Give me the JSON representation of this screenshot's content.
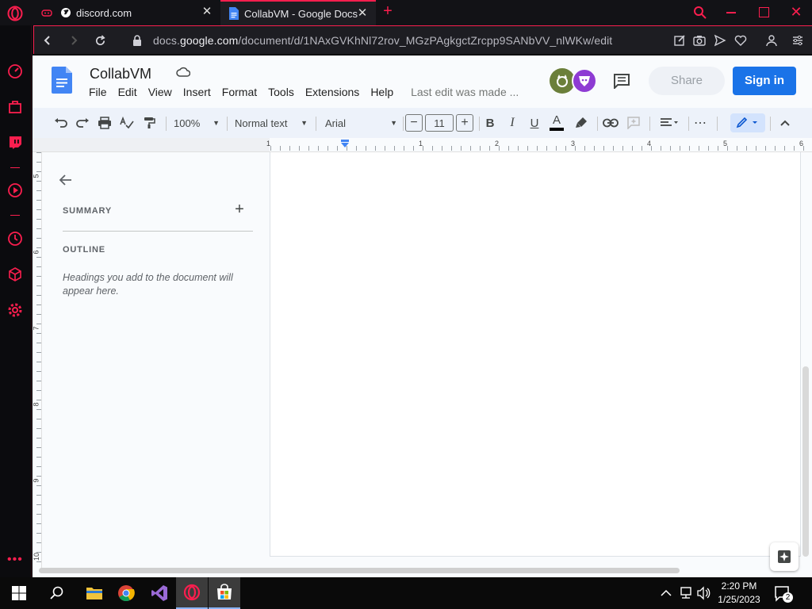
{
  "browser": {
    "tabs": [
      {
        "title": "discord.com",
        "icon": "discord-icon",
        "active": false
      },
      {
        "title": "CollabVM - Google Docs",
        "icon": "google-docs-icon",
        "active": true
      }
    ],
    "url_prefix": "docs.",
    "url_domain": "google.com",
    "url_path": "/document/d/1NAxGVKhNl72rov_MGzPAgkgctZrcpp9SANbVV_nlWKw/edit",
    "accent": "#fa1e4e"
  },
  "doc": {
    "title": "CollabVM",
    "menu": [
      "File",
      "Edit",
      "View",
      "Insert",
      "Format",
      "Tools",
      "Extensions",
      "Help"
    ],
    "last_edit": "Last edit was made ...",
    "share_label": "Share",
    "signin_label": "Sign in",
    "toolbar": {
      "zoom": "100%",
      "style": "Normal text",
      "font": "Arial",
      "font_size": "11"
    },
    "ruler_h": [
      "1",
      "1",
      "2",
      "3",
      "4",
      "5",
      "6"
    ],
    "ruler_v": [
      "5",
      "6",
      "7",
      "8",
      "9",
      "10"
    ],
    "outline": {
      "summary_label": "SUMMARY",
      "outline_label": "OUTLINE",
      "hint": "Headings you add to the document will appear here."
    }
  },
  "taskbar": {
    "time": "2:20 PM",
    "date": "1/25/2023",
    "notification_count": "2"
  }
}
